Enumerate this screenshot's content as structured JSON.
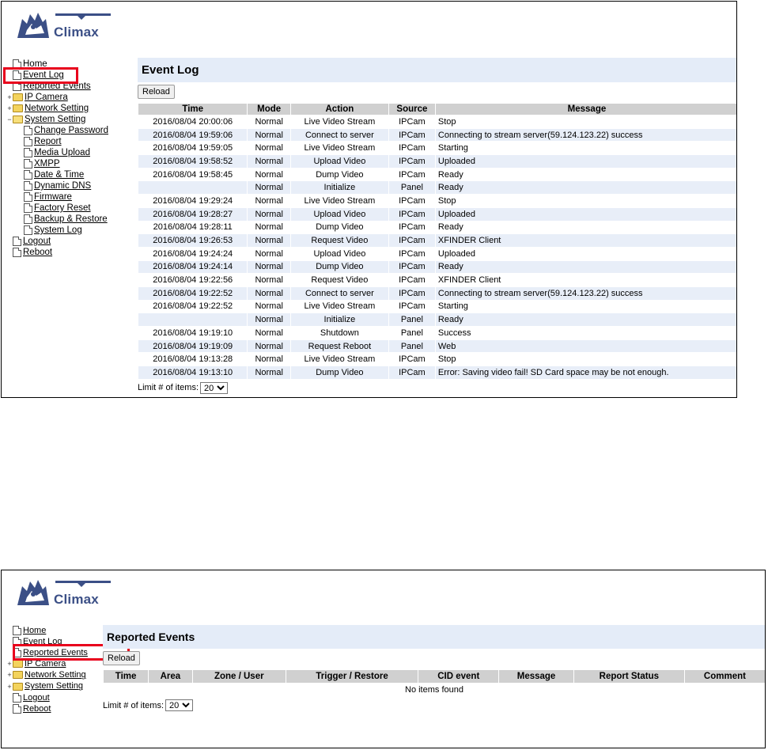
{
  "brand": {
    "name": "Climax"
  },
  "panel1": {
    "nav": [
      {
        "label": "Home",
        "type": "doc",
        "level": 0
      },
      {
        "label": "Event Log",
        "type": "doc",
        "level": 0
      },
      {
        "label": "Reported Events",
        "type": "doc",
        "level": 0
      },
      {
        "label": "IP Camera",
        "type": "folder",
        "level": 0,
        "expander": "+"
      },
      {
        "label": "Network Setting",
        "type": "folder",
        "level": 0,
        "expander": "+"
      },
      {
        "label": "System Setting",
        "type": "folder-open",
        "level": 0,
        "expander": "−"
      },
      {
        "label": "Change Password",
        "type": "doc",
        "level": 1
      },
      {
        "label": "Report",
        "type": "doc",
        "level": 1
      },
      {
        "label": "Media Upload",
        "type": "doc",
        "level": 1
      },
      {
        "label": "XMPP",
        "type": "doc",
        "level": 1
      },
      {
        "label": "Date & Time",
        "type": "doc",
        "level": 1
      },
      {
        "label": "Dynamic DNS",
        "type": "doc",
        "level": 1
      },
      {
        "label": "Firmware",
        "type": "doc",
        "level": 1
      },
      {
        "label": "Factory Reset",
        "type": "doc",
        "level": 1
      },
      {
        "label": "Backup & Restore",
        "type": "doc",
        "level": 1
      },
      {
        "label": "System Log",
        "type": "doc",
        "level": 1
      },
      {
        "label": "Logout",
        "type": "doc",
        "level": 0
      },
      {
        "label": "Reboot",
        "type": "doc",
        "level": 0
      }
    ],
    "title": "Event Log",
    "reload_label": "Reload",
    "columns": [
      "Time",
      "Mode",
      "Action",
      "Source",
      "Message"
    ],
    "rows": [
      [
        "2016/08/04 20:00:06",
        "Normal",
        "Live Video Stream",
        "IPCam",
        "Stop"
      ],
      [
        "2016/08/04 19:59:06",
        "Normal",
        "Connect to server",
        "IPCam",
        "Connecting to stream server(59.124.123.22) success"
      ],
      [
        "2016/08/04 19:59:05",
        "Normal",
        "Live Video Stream",
        "IPCam",
        "Starting"
      ],
      [
        "2016/08/04 19:58:52",
        "Normal",
        "Upload Video",
        "IPCam",
        "Uploaded"
      ],
      [
        "2016/08/04 19:58:45",
        "Normal",
        "Dump Video",
        "IPCam",
        "Ready"
      ],
      [
        "",
        "Normal",
        "Initialize",
        "Panel",
        "Ready"
      ],
      [
        "2016/08/04 19:29:24",
        "Normal",
        "Live Video Stream",
        "IPCam",
        "Stop"
      ],
      [
        "2016/08/04 19:28:27",
        "Normal",
        "Upload Video",
        "IPCam",
        "Uploaded"
      ],
      [
        "2016/08/04 19:28:11",
        "Normal",
        "Dump Video",
        "IPCam",
        "Ready"
      ],
      [
        "2016/08/04 19:26:53",
        "Normal",
        "Request Video",
        "IPCam",
        "XFINDER Client"
      ],
      [
        "2016/08/04 19:24:24",
        "Normal",
        "Upload Video",
        "IPCam",
        "Uploaded"
      ],
      [
        "2016/08/04 19:24:14",
        "Normal",
        "Dump Video",
        "IPCam",
        "Ready"
      ],
      [
        "2016/08/04 19:22:56",
        "Normal",
        "Request Video",
        "IPCam",
        "XFINDER Client"
      ],
      [
        "2016/08/04 19:22:52",
        "Normal",
        "Connect to server",
        "IPCam",
        "Connecting to stream server(59.124.123.22) success"
      ],
      [
        "2016/08/04 19:22:52",
        "Normal",
        "Live Video Stream",
        "IPCam",
        "Starting"
      ],
      [
        "",
        "Normal",
        "Initialize",
        "Panel",
        "Ready"
      ],
      [
        "2016/08/04 19:19:10",
        "Normal",
        "Shutdown",
        "Panel",
        "Success"
      ],
      [
        "2016/08/04 19:19:09",
        "Normal",
        "Request Reboot",
        "Panel",
        "Web"
      ],
      [
        "2016/08/04 19:13:28",
        "Normal",
        "Live Video Stream",
        "IPCam",
        "Stop"
      ],
      [
        "2016/08/04 19:13:10",
        "Normal",
        "Dump Video",
        "IPCam",
        "Error: Saving video fail! SD Card space may be not enough."
      ]
    ],
    "limit_label": "Limit # of items:",
    "limit_value": "20"
  },
  "panel2": {
    "nav": [
      {
        "label": "Home",
        "type": "doc",
        "level": 0
      },
      {
        "label": "Event Log",
        "type": "doc",
        "level": 0
      },
      {
        "label": "Reported Events",
        "type": "doc",
        "level": 0
      },
      {
        "label": "IP Camera",
        "type": "folder",
        "level": 0,
        "expander": "+"
      },
      {
        "label": "Network Setting",
        "type": "folder",
        "level": 0,
        "expander": "+"
      },
      {
        "label": "System Setting",
        "type": "folder",
        "level": 0,
        "expander": "+"
      },
      {
        "label": "Logout",
        "type": "doc",
        "level": 0
      },
      {
        "label": "Reboot",
        "type": "doc",
        "level": 0
      }
    ],
    "title": "Reported Events",
    "reload_label": "Reload",
    "columns": [
      "Time",
      "Area",
      "Zone / User",
      "Trigger / Restore",
      "CID event",
      "Message",
      "Report Status",
      "Comment"
    ],
    "empty_text": "No items found",
    "limit_label": "Limit # of items:",
    "limit_value": "20"
  },
  "colors": {
    "highlight": "#e8001c",
    "title_bg": "#e4ecf8",
    "row_alt": "#e8eef8",
    "header_bg": "#d0d0d0",
    "brand": "#3b4f86"
  }
}
